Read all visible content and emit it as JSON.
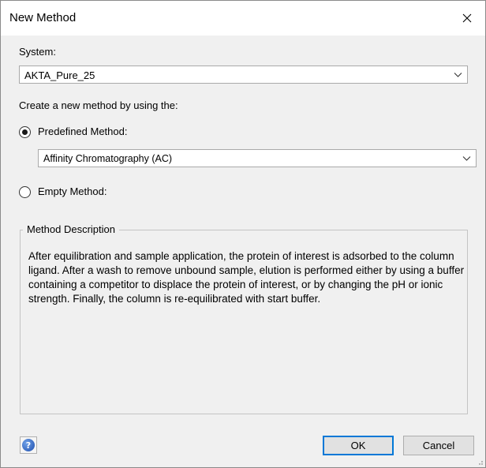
{
  "window": {
    "title": "New Method"
  },
  "system": {
    "label": "System:",
    "selected": "AKTA_Pure_25"
  },
  "create_label": "Create a new method by using the:",
  "predefined": {
    "label": "Predefined Method:",
    "selected": "Affinity Chromatography (AC)",
    "checked": true
  },
  "empty": {
    "label": "Empty Method:",
    "checked": false
  },
  "description": {
    "title": "Method Description",
    "text": "After equilibration and sample application, the protein of interest is adsorbed to the column ligand. After a wash to remove unbound sample, elution is performed either by using a buffer containing a competitor to displace the protein of interest, or by changing the pH or ionic strength. Finally, the column is re-equilibrated with start buffer."
  },
  "buttons": {
    "help": "?",
    "ok": "OK",
    "cancel": "Cancel"
  },
  "icons": {
    "close": "close-icon",
    "dropdown": "chevron-down-icon",
    "help": "help-icon"
  }
}
